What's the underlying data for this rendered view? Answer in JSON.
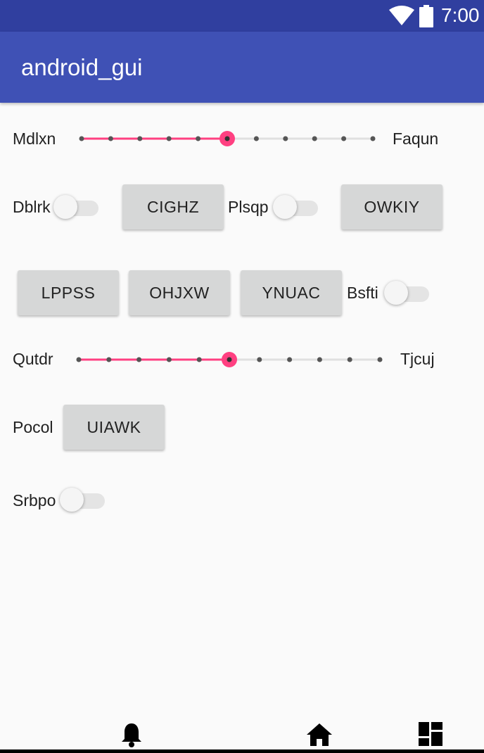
{
  "status_bar": {
    "time": "7:00",
    "wifi_icon": "wifi-icon",
    "battery_icon": "battery-icon"
  },
  "app_bar": {
    "title": "android_gui"
  },
  "slider1": {
    "left_label": "Mdlxn",
    "right_label": "Faqun",
    "steps": 10,
    "value": 5
  },
  "row2": {
    "switch1_label": "Dblrk",
    "switch1_on": false,
    "button1": "CIGHZ",
    "switch2_label": "Plsqp",
    "switch2_on": false,
    "button2": "OWKIY"
  },
  "row3": {
    "button1": "LPPSS",
    "button2": "OHJXW",
    "button3": "YNUAC",
    "switch_label": "Bsfti",
    "switch_on": false
  },
  "slider2": {
    "left_label": "Qutdr",
    "right_label": "Tjcuj",
    "steps": 10,
    "value": 5
  },
  "row5": {
    "label": "Pocol",
    "button": "UIAWK"
  },
  "row6": {
    "switch_label": "Srbpo",
    "switch_on": false
  },
  "nav_bar": {
    "icons": [
      "bell-icon",
      "home-icon",
      "dashboard-icon"
    ]
  },
  "colors": {
    "status_bar": "#303f9f",
    "app_bar": "#3f51b5",
    "accent": "#ff4081",
    "background": "#fafafa"
  }
}
